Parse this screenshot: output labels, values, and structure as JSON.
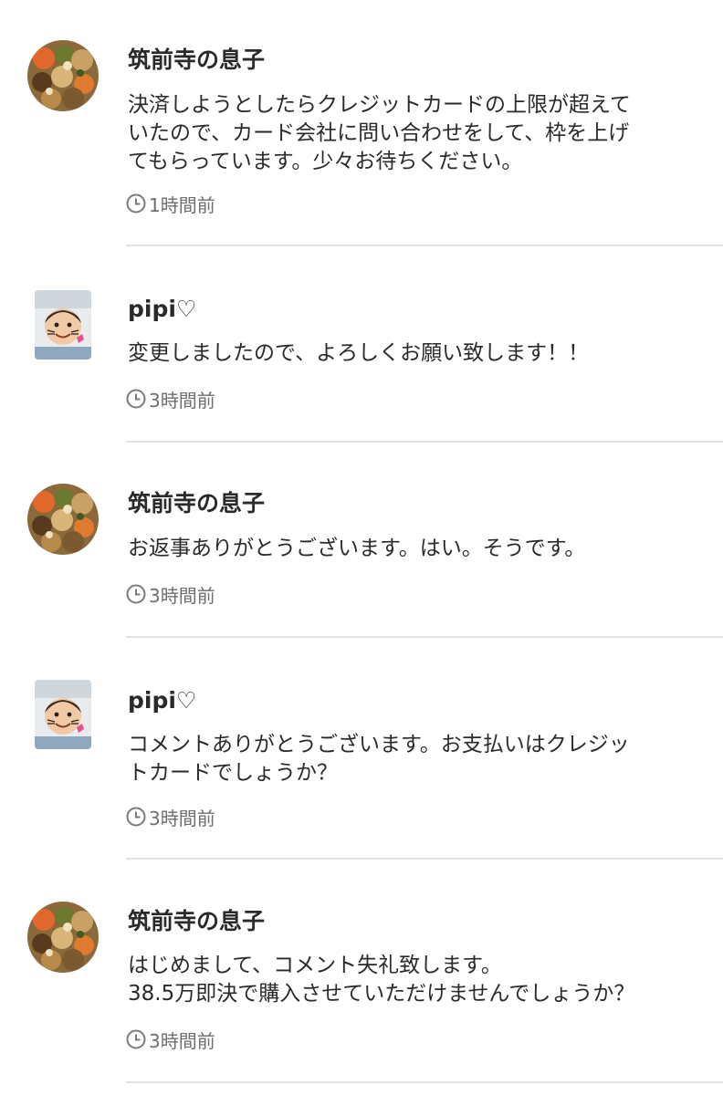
{
  "comments": [
    {
      "user": "筑前寺の息子",
      "avatar": "food-avatar",
      "lines": [
        "決済しようとしたらクレジットカードの上限が超えて",
        "いたので、カード会社に問い合わせをして、枠を上げ",
        "てもらっています。少々お待ちください。"
      ],
      "time": "1時間前"
    },
    {
      "user": "pipi♡",
      "avatar": "child-avatar",
      "lines": [
        "変更しましたので、よろしくお願い致します！！"
      ],
      "time": "3時間前"
    },
    {
      "user": "筑前寺の息子",
      "avatar": "food-avatar",
      "lines": [
        "お返事ありがとうございます。はい。そうです。"
      ],
      "time": "3時間前"
    },
    {
      "user": "pipi♡",
      "avatar": "child-avatar",
      "lines": [
        "コメントありがとうございます。お支払いはクレジッ",
        "トカードでしょうか？"
      ],
      "time": "3時間前"
    },
    {
      "user": "筑前寺の息子",
      "avatar": "food-avatar",
      "lines": [
        "はじめまして、コメント失礼致します。",
        "38.5万即決で購入させていただけませんでしょうか？"
      ],
      "time": "3時間前"
    }
  ]
}
